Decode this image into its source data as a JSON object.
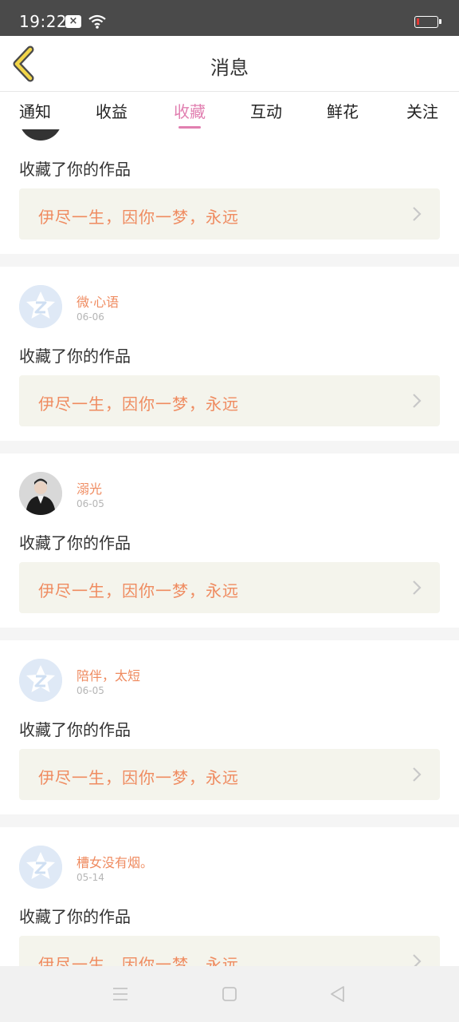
{
  "status": {
    "time": "19:22",
    "sim_label": "×"
  },
  "header": {
    "title": "消息"
  },
  "tabs": [
    {
      "label": "通知"
    },
    {
      "label": "收益"
    },
    {
      "label": "收藏"
    },
    {
      "label": "互动"
    },
    {
      "label": "鲜花"
    },
    {
      "label": "关注"
    }
  ],
  "active_tab": "收藏",
  "colors": {
    "accent": "#e17fb0",
    "orange": "#ef8b60",
    "work_bg": "#f4f4ec",
    "back_arrow": "#f2d548"
  },
  "feed": {
    "partial_top": {
      "action": "收藏了你的作品",
      "work_title": "伊尽一生，因你一梦，永远"
    },
    "items": [
      {
        "username": "微·心语",
        "date": "06-06",
        "avatar": "default-avatar-icon",
        "action": "收藏了你的作品",
        "work_title": "伊尽一生，因你一梦，永远"
      },
      {
        "username": "溺光",
        "date": "06-05",
        "avatar": "photo-avatar",
        "action": "收藏了你的作品",
        "work_title": "伊尽一生，因你一梦，永远"
      },
      {
        "username": "陪伴，太短",
        "date": "06-05",
        "avatar": "default-avatar-icon",
        "action": "收藏了你的作品",
        "work_title": "伊尽一生，因你一梦，永远"
      },
      {
        "username": "槽女没有烟。",
        "date": "05-14",
        "avatar": "default-avatar-icon",
        "action": "收藏了你的作品",
        "work_title": "伊尽一生，因你一梦，永远"
      }
    ]
  },
  "navbar": {
    "icons": [
      "menu-icon",
      "home-icon",
      "back-triangle-icon"
    ]
  }
}
